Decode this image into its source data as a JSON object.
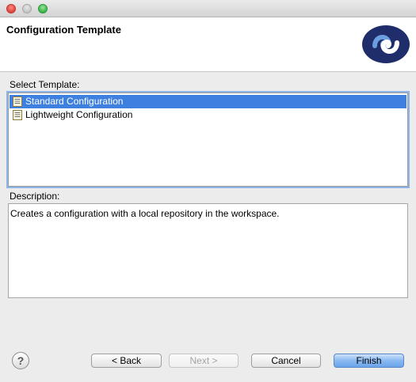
{
  "window": {
    "controls": [
      "close-icon",
      "minimize-icon",
      "zoom-icon"
    ]
  },
  "header": {
    "title": "Configuration Template",
    "logo_icon": "product-logo-icon"
  },
  "templates": {
    "label": "Select Template:",
    "items": [
      {
        "label": "Standard Configuration",
        "icon": "document-icon",
        "selected": true
      },
      {
        "label": "Lightweight Configuration",
        "icon": "document-icon",
        "selected": false
      }
    ]
  },
  "description": {
    "label": "Description:",
    "text": "Creates a configuration with a local repository in the workspace."
  },
  "footer": {
    "help_icon": "help-icon",
    "help_glyph": "?",
    "back_label": "< Back",
    "next_label": "Next >",
    "cancel_label": "Cancel",
    "finish_label": "Finish"
  },
  "colors": {
    "selection": "#3d80df",
    "logo_dark": "#1f2d6b",
    "logo_light": "#5b8ed6",
    "default_button": "#8ab9f1"
  }
}
